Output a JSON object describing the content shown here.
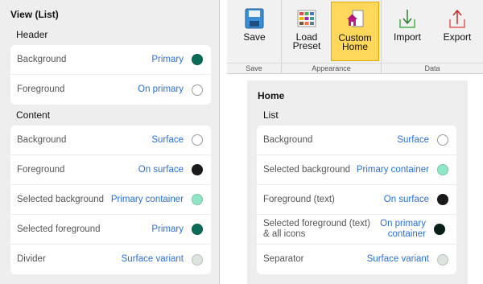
{
  "left_panel": {
    "title": "View (List)",
    "sections": [
      {
        "label": "Header",
        "rows": [
          {
            "label": "Background",
            "value": "Primary",
            "color": "#0a6b57"
          },
          {
            "label": "Foreground",
            "value": "On primary",
            "color": "#ffffff"
          }
        ]
      },
      {
        "label": "Content",
        "rows": [
          {
            "label": "Background",
            "value": "Surface",
            "color": "#ffffff"
          },
          {
            "label": "Foreground",
            "value": "On surface",
            "color": "#1a1a1a"
          },
          {
            "label": "Selected background",
            "value": "Primary container",
            "color": "#8fe8c5"
          },
          {
            "label": "Selected foreground",
            "value": "Primary",
            "color": "#0a6b57"
          },
          {
            "label": "Divider",
            "value": "Surface variant",
            "color": "#dde3df"
          }
        ]
      }
    ]
  },
  "ribbon": {
    "groups": [
      {
        "label": "Save",
        "buttons": [
          {
            "label": "Save",
            "icon": "save-icon"
          }
        ]
      },
      {
        "label": "Appearance",
        "buttons": [
          {
            "label": "Load Preset",
            "icon": "color-grid-icon"
          },
          {
            "label": "Custom Home",
            "icon": "home-icon",
            "active": true
          }
        ]
      },
      {
        "label": "Data",
        "buttons": [
          {
            "label": "Import",
            "icon": "import-icon"
          },
          {
            "label": "Export",
            "icon": "export-icon"
          }
        ]
      }
    ]
  },
  "right_panel": {
    "title": "Home",
    "section_label": "List",
    "rows": [
      {
        "label": "Background",
        "value": "Surface",
        "color": "#ffffff"
      },
      {
        "label": "Selected background",
        "value": "Primary container",
        "color": "#8fe8c5"
      },
      {
        "label": "Foreground (text)",
        "value": "On surface",
        "color": "#1a1a1a"
      },
      {
        "label": "Selected foreground (text) & all icons",
        "value": "On primary container",
        "color": "#08201a"
      },
      {
        "label": "Separator",
        "value": "Surface variant",
        "color": "#dde3df"
      }
    ]
  }
}
